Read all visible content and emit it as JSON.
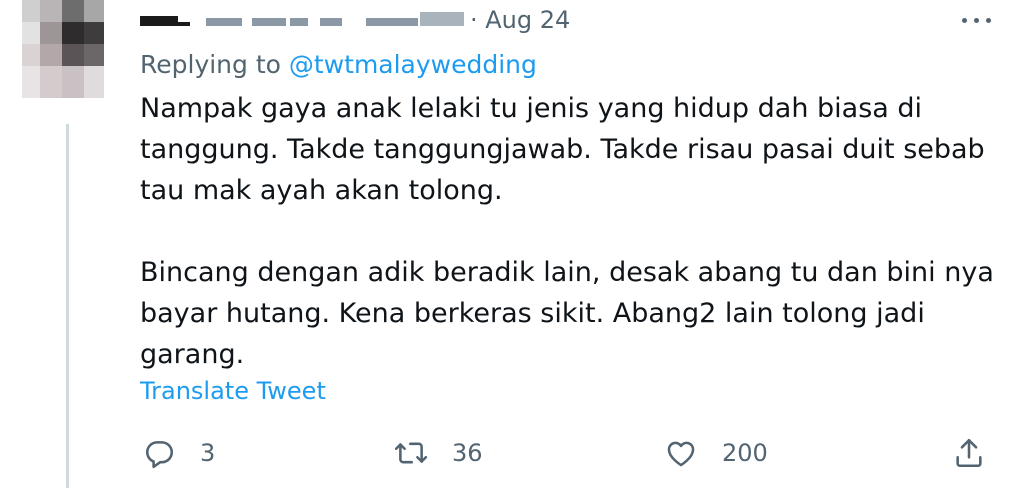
{
  "tweet": {
    "date": "· Aug 24",
    "replying_prefix": "Replying to ",
    "replying_handle": "@twtmalaywedding",
    "text_lines": [
      "Nampak gaya anak lelaki tu jenis yang  hidup dah biasa di",
      "tanggung. Takde tanggungjawab. Takde risau pasai duit sebab",
      "tau mak ayah akan tolong.",
      "Bincang dengan adik beradik lain, desak abang  tu dan bini nya",
      "bayar hutang. Kena berkeras sikit. Abang2 lain tolong jadi",
      "garang."
    ],
    "translate_label": "Translate Tweet"
  },
  "actions": {
    "reply_count": "3",
    "retweet_count": "36",
    "like_count": "200"
  },
  "icons": {
    "more": "more-horizontal-icon",
    "reply": "reply-bubble-icon",
    "retweet": "retweet-arrows-icon",
    "like": "heart-icon",
    "share": "share-upload-icon"
  },
  "colors": {
    "text": "#0f1419",
    "secondary": "#536471",
    "accent": "#1d9bf0",
    "thread_line": "#cfd9de"
  }
}
